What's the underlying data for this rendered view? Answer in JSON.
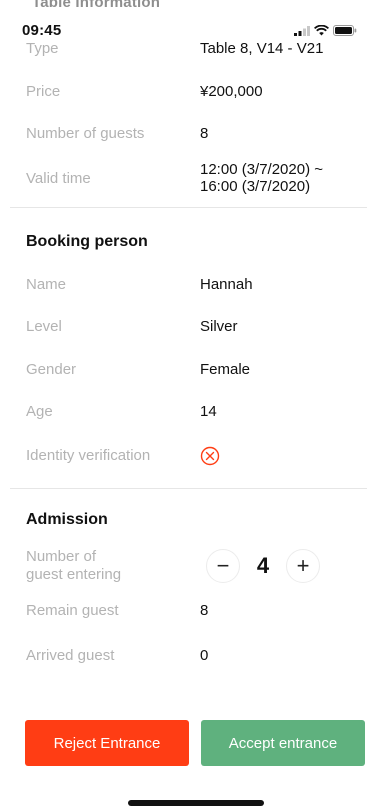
{
  "status_bar": {
    "time": "09:45",
    "hidden_header": "Table Information"
  },
  "table_info": [
    {
      "label": "Type",
      "value": "Table 8, V14 - V21"
    },
    {
      "label": "Price",
      "value": "¥200,000"
    },
    {
      "label": "Number of guests",
      "value": "8"
    },
    {
      "label": "Valid time",
      "value_line1": "12:00 (3/7/2020) ~",
      "value_line2": "16:00 (3/7/2020)"
    }
  ],
  "booking_person": {
    "title": "Booking person",
    "rows": [
      {
        "label": "Name",
        "value": "Hannah"
      },
      {
        "label": "Level",
        "value": "Silver"
      },
      {
        "label": "Gender",
        "value": "Female"
      },
      {
        "label": "Age",
        "value": "14"
      }
    ],
    "identity_label": "Identity verification",
    "identity_status_icon": "x-circle-icon",
    "identity_status_color": "#ff3d14"
  },
  "admission": {
    "title": "Admission",
    "entering_label_line1": "Number of",
    "entering_label_line2": "guest entering",
    "entering_count": "4",
    "minus_symbol": "−",
    "plus_symbol": "+",
    "rows": [
      {
        "label": "Remain guest",
        "value": "8"
      },
      {
        "label": "Arrived guest",
        "value": "0"
      }
    ]
  },
  "actions": {
    "reject_label": "Reject Entrance",
    "accept_label": "Accept entrance",
    "reject_color": "#ff3d14",
    "accept_color": "#5fb17e"
  }
}
